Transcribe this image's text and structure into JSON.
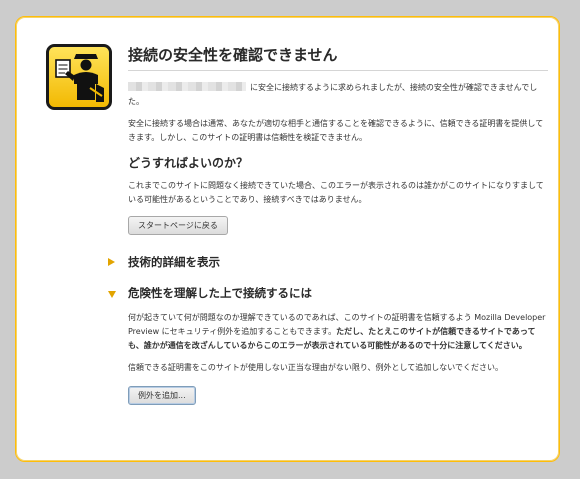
{
  "page": {
    "title": "接続の安全性を確認できません",
    "intro_after_host": "に安全に接続するように求められましたが、接続の安全性が確認できませんでした。",
    "normal_info": "安全に接続する場合は通常、あなたが適切な相手と通信することを確認できるように、信頼できる証明書を提供してきます。しかし、このサイトの証明書は信頼性を検証できません。"
  },
  "what_to_do": {
    "heading": "どうすればよいのか？",
    "text": "これまでこのサイトに問題なく接続できていた場合、このエラーが表示されるのは誰かがこのサイトになりすましている可能性があるということであり、接続すべきではありません。",
    "start_button": "スタートページに戻る"
  },
  "technical": {
    "label": "技術的詳細を表示"
  },
  "expert": {
    "label": "危険性を理解した上で接続するには",
    "text_normal": "何が起きていて何が問題なのか理解できているのであれば、このサイトの証明書を信頼するよう Mozilla Developer Preview にセキュリティ例外を追加することもできます。",
    "text_bold": "ただし、たとえこのサイトが信頼できるサイトであっても、誰かが通信を改ざんしているからこのエラーが表示されている可能性があるので十分に注意してください。",
    "text2": "信頼できる証明書をこのサイトが使用しない正当な理由がない限り、例外として追加しないでください。",
    "add_button": "例外を追加..."
  },
  "colors": {
    "accent": "#ffbd09",
    "arrow": "#e2a400",
    "background": "#cccccc"
  }
}
